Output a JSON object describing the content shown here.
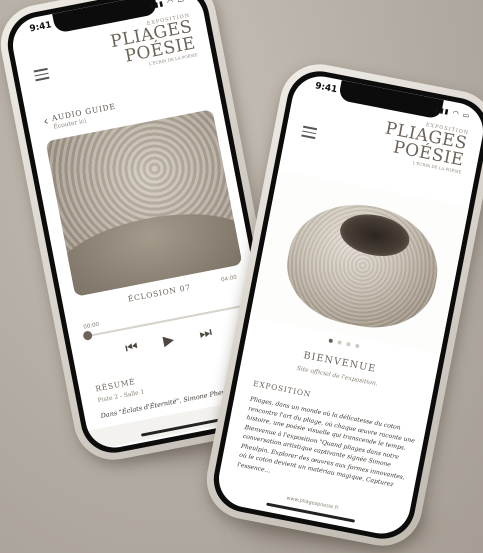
{
  "status_bar": {
    "time": "9:41",
    "icons": "▮▮▮ ◠ ▭"
  },
  "brand": {
    "pre": "EXPOSITION",
    "line1": "PLIAGES",
    "line2": "POÉSIE",
    "tagline": "L'ÉCRIN DE LA POÉSIE"
  },
  "audio_guide": {
    "title": "AUDIO GUIDE",
    "subtitle": "Écouter ici",
    "track_title": "ÉCLOSION 07",
    "track_duration": "04:00",
    "time_elapsed": "00:00",
    "progress_fraction": 0.0,
    "controls": {
      "previous_icon": "⏮",
      "play_icon": "▶",
      "next_icon": "⏭"
    },
    "summary_title": "RÉSUMÉ",
    "summary_meta": "Piste 2 - Salle 1",
    "summary_body": "Dans \"Éclats d'Éternité\", Simone Pheulpin..."
  },
  "home": {
    "welcome_title": "BIENVENUE",
    "welcome_subtitle": "Site officiel de l'exposition.",
    "carousel": {
      "count": 4,
      "active_index": 0
    },
    "exposition_title": "EXPOSITION",
    "exposition_text": "Pliages, dans un monde où la délicatesse du coton rencontre l'art du pliage, où chaque œuvre raconte une histoire, une poésie visuelle qui transcende le temps. Bienvenue à l'exposition \"Quand pliages dans notre conversation artistique captivante signée Simone Pheulpin. Explorer des œuvres aux formes innovantes, où le coton devient un matériau magique. Capturez l'essence...",
    "footer": "www.pliagespoesie.fr"
  },
  "colors": {
    "accent": "#6b6257",
    "background": "#b3aca3",
    "frame": "#dcd7cf"
  }
}
